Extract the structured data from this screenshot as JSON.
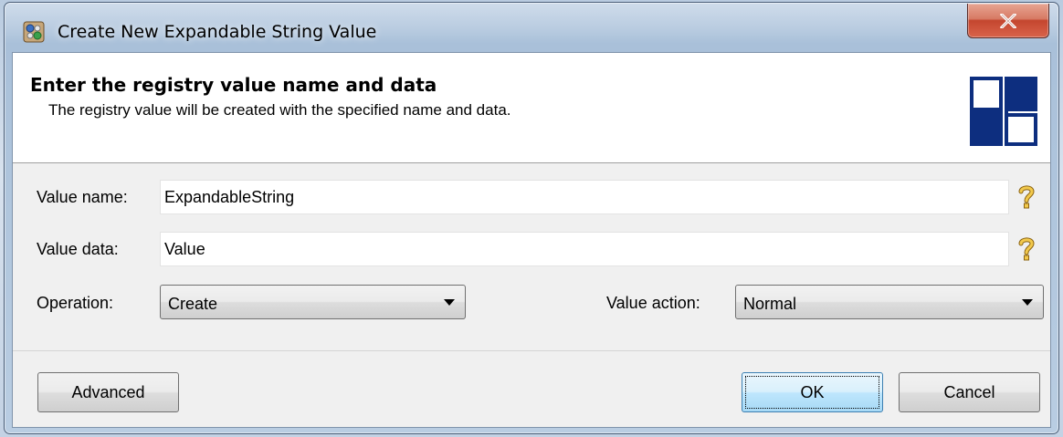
{
  "window": {
    "title": "Create New Expandable String Value",
    "close_symbol": "X"
  },
  "header": {
    "title": "Enter the registry value name and data",
    "subtitle": "The registry value will be created with the specified name and data."
  },
  "fields": {
    "value_name": {
      "label": "Value name:",
      "value": "ExpandableString"
    },
    "value_data": {
      "label": "Value data:",
      "value": "Value"
    },
    "operation": {
      "label": "Operation:",
      "selected": "Create"
    },
    "value_action": {
      "label": "Value action:",
      "selected": "Normal"
    }
  },
  "help_glyph": "?",
  "buttons": {
    "advanced": "Advanced",
    "ok": "OK",
    "cancel": "Cancel"
  },
  "icons": {
    "title": "registry-app-icon",
    "help": "question-mark-icon",
    "logo": "squares-logo-icon",
    "dropdown": "chevron-down-icon",
    "close": "close-icon"
  },
  "colors": {
    "logo_navy": "#0d2e7f",
    "help_gold": "#d9a524",
    "close_red": "#c4462f"
  }
}
